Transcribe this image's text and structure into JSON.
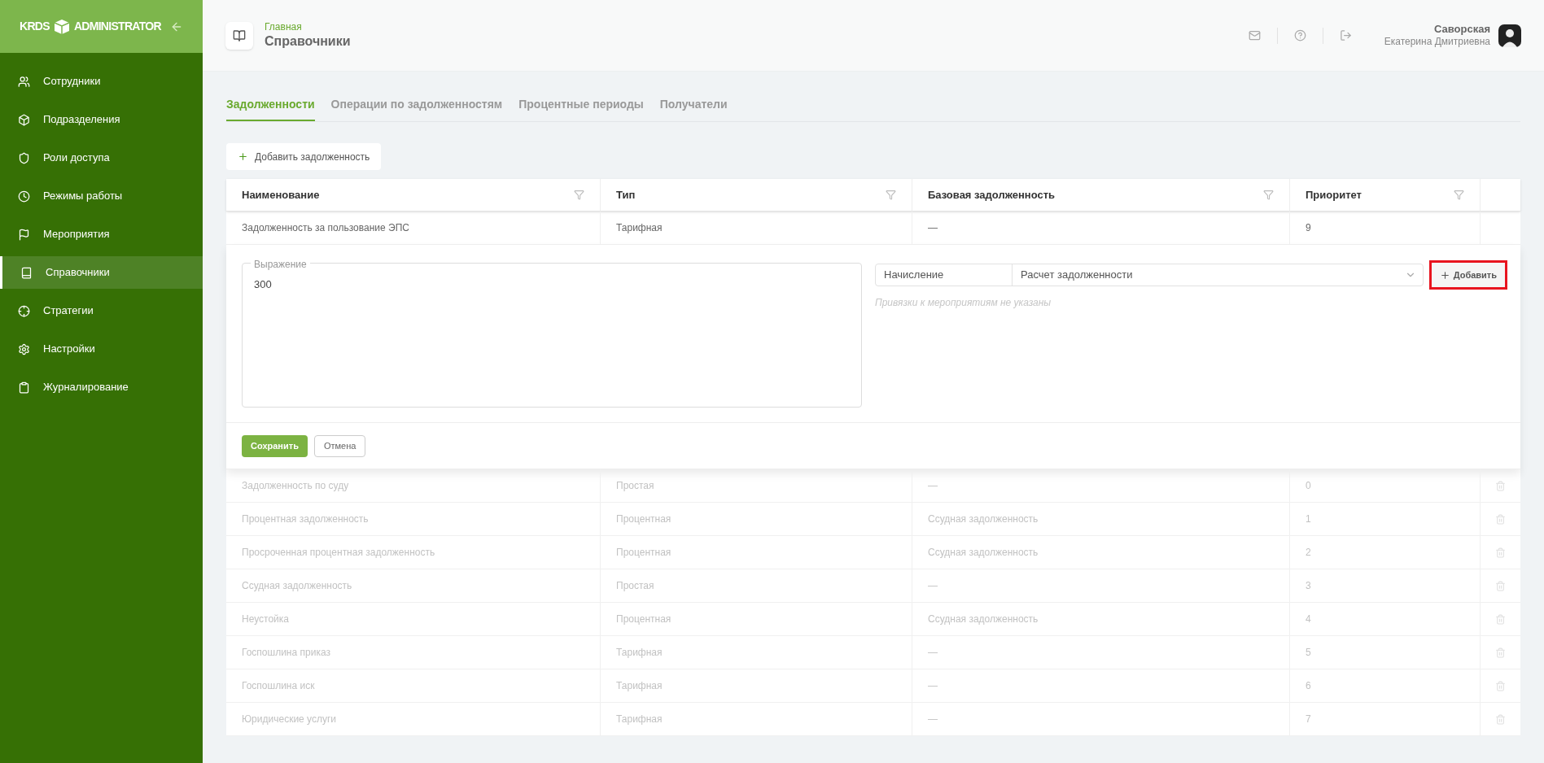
{
  "sidebar": {
    "logo_left": "KRDS",
    "logo_right": "ADMINISTRATOR",
    "items": [
      {
        "label": "Сотрудники",
        "selected": false
      },
      {
        "label": "Подразделения",
        "selected": false
      },
      {
        "label": "Роли доступа",
        "selected": false
      },
      {
        "label": "Режимы работы",
        "selected": false
      },
      {
        "label": "Мероприятия",
        "selected": false
      },
      {
        "label": "Справочники",
        "selected": true
      },
      {
        "label": "Стратегии",
        "selected": false
      },
      {
        "label": "Настройки",
        "selected": false
      },
      {
        "label": "Журналирование",
        "selected": false
      }
    ]
  },
  "header": {
    "breadcrumb": "Главная",
    "title": "Справочники",
    "user_last": "Саворская",
    "user_first": "Екатерина Дмитриевна"
  },
  "tabs": [
    {
      "label": "Задолженности",
      "selected": true
    },
    {
      "label": "Операции по задолженностям",
      "selected": false
    },
    {
      "label": "Процентные периоды",
      "selected": false
    },
    {
      "label": "Получатели",
      "selected": false
    }
  ],
  "add_button": "Добавить задолженность",
  "table": {
    "columns": [
      "Наименование",
      "Тип",
      "Базовая задолженность",
      "Приоритет"
    ],
    "rows": [
      {
        "cells": [
          "Задолженность за пользование ЭПС",
          "Тарифная",
          "—",
          "9"
        ],
        "expanded": true,
        "disabled": false
      },
      {
        "cells": [
          "Задолженность по суду",
          "Простая",
          "—",
          "0"
        ],
        "expanded": false,
        "disabled": true
      },
      {
        "cells": [
          "Процентная задолженность",
          "Процентная",
          "Ссудная задолженность",
          "1"
        ],
        "expanded": false,
        "disabled": true
      },
      {
        "cells": [
          "Просроченная процентная задолженность",
          "Процентная",
          "Ссудная задолженность",
          "2"
        ],
        "expanded": false,
        "disabled": true
      },
      {
        "cells": [
          "Ссудная задолженность",
          "Простая",
          "—",
          "3"
        ],
        "expanded": false,
        "disabled": true
      },
      {
        "cells": [
          "Неустойка",
          "Процентная",
          "Ссудная задолженность",
          "4"
        ],
        "expanded": false,
        "disabled": true
      },
      {
        "cells": [
          "Госпошлина приказ",
          "Тарифная",
          "—",
          "5"
        ],
        "expanded": false,
        "disabled": true
      },
      {
        "cells": [
          "Госпошлина иск",
          "Тарифная",
          "—",
          "6"
        ],
        "expanded": false,
        "disabled": true
      },
      {
        "cells": [
          "Юридические услуги",
          "Тарифная",
          "—",
          "7"
        ],
        "expanded": false,
        "disabled": true
      }
    ]
  },
  "editor": {
    "expression_label": "Выражение",
    "expression_value": "300",
    "binding_label": "Начисление",
    "binding_value": "Расчет задолженности",
    "add_label": "Добавить",
    "add_highlighted": true,
    "empty_note": "Привязки к мероприятиям не указаны",
    "save": "Сохранить",
    "cancel": "Отмена"
  }
}
